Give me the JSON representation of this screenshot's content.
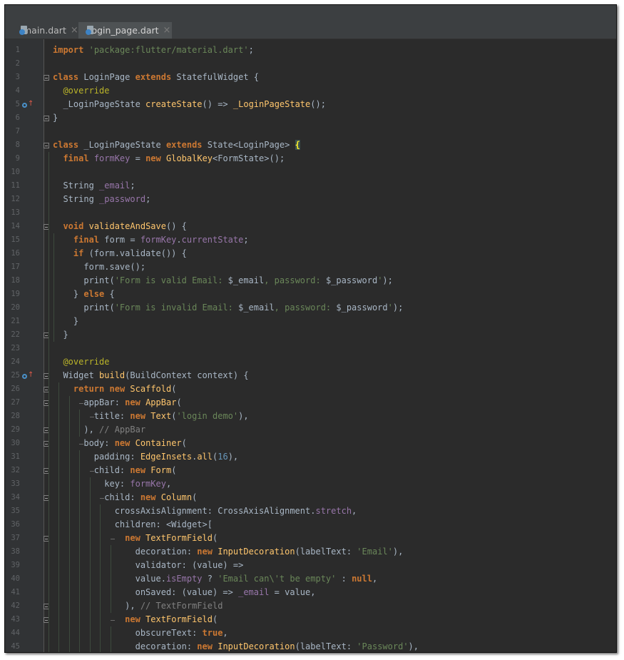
{
  "tabs": [
    {
      "name": "main.dart",
      "active": false
    },
    {
      "name": "login_page.dart",
      "active": true
    }
  ],
  "close_glyph": "×",
  "lines": [
    [
      [
        "kw",
        "import"
      ],
      [
        "t",
        " "
      ],
      [
        "str",
        "'package:flutter/material.dart'"
      ],
      [
        "t",
        ";"
      ]
    ],
    [],
    [
      [
        "kw",
        "class"
      ],
      [
        "t",
        " LoginPage "
      ],
      [
        "kw",
        "extends"
      ],
      [
        "t",
        " StatefulWidget {"
      ]
    ],
    [
      [
        "t",
        "  "
      ],
      [
        "meta",
        "@override"
      ]
    ],
    [
      [
        "t",
        "  _LoginPageState "
      ],
      [
        "fn",
        "createState"
      ],
      [
        "t",
        "() => "
      ],
      [
        "fn",
        "_LoginPageState"
      ],
      [
        "t",
        "();"
      ]
    ],
    [
      [
        "t",
        "}"
      ]
    ],
    [],
    [
      [
        "kw",
        "class"
      ],
      [
        "t",
        " _LoginPageState "
      ],
      [
        "kw",
        "extends"
      ],
      [
        "t",
        " State<LoginPage> "
      ],
      [
        "hl",
        "{"
      ]
    ],
    [
      [
        "t",
        "  "
      ],
      [
        "kw",
        "final"
      ],
      [
        "t",
        " "
      ],
      [
        "prop",
        "formKey"
      ],
      [
        "t",
        " = "
      ],
      [
        "kw",
        "new"
      ],
      [
        "t",
        " "
      ],
      [
        "fn",
        "GlobalKey"
      ],
      [
        "t",
        "<FormState>();"
      ]
    ],
    [],
    [
      [
        "t",
        "  String "
      ],
      [
        "prop",
        "_email"
      ],
      [
        "t",
        ";"
      ]
    ],
    [
      [
        "t",
        "  String "
      ],
      [
        "prop",
        "_password"
      ],
      [
        "t",
        ";"
      ]
    ],
    [],
    [
      [
        "t",
        "  "
      ],
      [
        "kw",
        "void"
      ],
      [
        "t",
        " "
      ],
      [
        "fn",
        "validateAndSave"
      ],
      [
        "t",
        "() {"
      ]
    ],
    [
      [
        "t",
        "    "
      ],
      [
        "kw",
        "final"
      ],
      [
        "t",
        " form = "
      ],
      [
        "prop",
        "formKey"
      ],
      [
        "t",
        "."
      ],
      [
        "prop",
        "currentState"
      ],
      [
        "t",
        ";"
      ]
    ],
    [
      [
        "t",
        "    "
      ],
      [
        "kw",
        "if"
      ],
      [
        "t",
        " (form.validate()) {"
      ]
    ],
    [
      [
        "t",
        "      form.save();"
      ]
    ],
    [
      [
        "t",
        "      print("
      ],
      [
        "str",
        "'Form is valid Email: "
      ],
      [
        "t",
        "$_email"
      ],
      [
        "str",
        ", password: "
      ],
      [
        "t",
        "$_password"
      ],
      [
        "str",
        "'"
      ],
      [
        "t",
        ");"
      ]
    ],
    [
      [
        "t",
        "    } "
      ],
      [
        "kw",
        "else"
      ],
      [
        "t",
        " {"
      ]
    ],
    [
      [
        "t",
        "      print("
      ],
      [
        "str",
        "'Form is invalid Email: "
      ],
      [
        "t",
        "$_email"
      ],
      [
        "str",
        ", password: "
      ],
      [
        "t",
        "$_password"
      ],
      [
        "str",
        "'"
      ],
      [
        "t",
        ");"
      ]
    ],
    [
      [
        "t",
        "    }"
      ]
    ],
    [
      [
        "t",
        "  }"
      ]
    ],
    [],
    [
      [
        "t",
        "  "
      ],
      [
        "meta",
        "@override"
      ]
    ],
    [
      [
        "t",
        "  Widget "
      ],
      [
        "fn",
        "build"
      ],
      [
        "t",
        "(BuildContext context) {"
      ]
    ],
    [
      [
        "t",
        "    "
      ],
      [
        "kw",
        "return"
      ],
      [
        "t",
        " "
      ],
      [
        "kw",
        "new"
      ],
      [
        "t",
        " "
      ],
      [
        "fn",
        "Scaffold"
      ],
      [
        "t",
        "("
      ]
    ],
    [
      [
        "t",
        "      appBar: "
      ],
      [
        "kw",
        "new"
      ],
      [
        "t",
        " "
      ],
      [
        "fn",
        "AppBar"
      ],
      [
        "t",
        "("
      ]
    ],
    [
      [
        "t",
        "        title: "
      ],
      [
        "kw",
        "new"
      ],
      [
        "t",
        " "
      ],
      [
        "fn",
        "Text"
      ],
      [
        "t",
        "("
      ],
      [
        "str",
        "'login demo'"
      ],
      [
        "t",
        "),"
      ]
    ],
    [
      [
        "t",
        "      ), "
      ],
      [
        "cmt",
        "// AppBar"
      ]
    ],
    [
      [
        "t",
        "      body: "
      ],
      [
        "kw",
        "new"
      ],
      [
        "t",
        " "
      ],
      [
        "fn",
        "Container"
      ],
      [
        "t",
        "("
      ]
    ],
    [
      [
        "t",
        "        padding: "
      ],
      [
        "fn",
        "EdgeInsets"
      ],
      [
        "t",
        "."
      ],
      [
        "fn",
        "all"
      ],
      [
        "t",
        "("
      ],
      [
        "num",
        "16"
      ],
      [
        "t",
        "),"
      ]
    ],
    [
      [
        "t",
        "        child: "
      ],
      [
        "kw",
        "new"
      ],
      [
        "t",
        " "
      ],
      [
        "fn",
        "Form"
      ],
      [
        "t",
        "("
      ]
    ],
    [
      [
        "t",
        "          key: "
      ],
      [
        "prop",
        "formKey"
      ],
      [
        "t",
        ","
      ]
    ],
    [
      [
        "t",
        "          child: "
      ],
      [
        "kw",
        "new"
      ],
      [
        "t",
        " "
      ],
      [
        "fn",
        "Column"
      ],
      [
        "t",
        "("
      ]
    ],
    [
      [
        "t",
        "            crossAxisAlignment: CrossAxisAlignment."
      ],
      [
        "prop",
        "stretch"
      ],
      [
        "t",
        ","
      ]
    ],
    [
      [
        "t",
        "            children: <Widget>["
      ]
    ],
    [
      [
        "t",
        "              "
      ],
      [
        "kw",
        "new"
      ],
      [
        "t",
        " "
      ],
      [
        "fn",
        "TextFormField"
      ],
      [
        "t",
        "("
      ]
    ],
    [
      [
        "t",
        "                decoration: "
      ],
      [
        "kw",
        "new"
      ],
      [
        "t",
        " "
      ],
      [
        "fn",
        "InputDecoration"
      ],
      [
        "t",
        "(labelText: "
      ],
      [
        "str",
        "'Email'"
      ],
      [
        "t",
        "),"
      ]
    ],
    [
      [
        "t",
        "                validator: (value) =>"
      ]
    ],
    [
      [
        "t",
        "                value."
      ],
      [
        "prop",
        "isEmpty"
      ],
      [
        "t",
        " ? "
      ],
      [
        "str",
        "'Email can\\'t be empty'"
      ],
      [
        "t",
        " : "
      ],
      [
        "kw",
        "null"
      ],
      [
        "t",
        ","
      ]
    ],
    [
      [
        "t",
        "                onSaved: (value) => "
      ],
      [
        "prop",
        "_email"
      ],
      [
        "t",
        " = value,"
      ]
    ],
    [
      [
        "t",
        "              ), "
      ],
      [
        "cmt",
        "// TextFormField"
      ]
    ],
    [
      [
        "t",
        "              "
      ],
      [
        "kw",
        "new"
      ],
      [
        "t",
        " "
      ],
      [
        "fn",
        "TextFormField"
      ],
      [
        "t",
        "("
      ]
    ],
    [
      [
        "t",
        "                obscureText: "
      ],
      [
        "kw",
        "true"
      ],
      [
        "t",
        ","
      ]
    ],
    [
      [
        "t",
        "                decoration: "
      ],
      [
        "kw",
        "new"
      ],
      [
        "t",
        " "
      ],
      [
        "fn",
        "InputDecoration"
      ],
      [
        "t",
        "(labelText: "
      ],
      [
        "str",
        "'Password'"
      ],
      [
        "t",
        "),"
      ]
    ]
  ]
}
